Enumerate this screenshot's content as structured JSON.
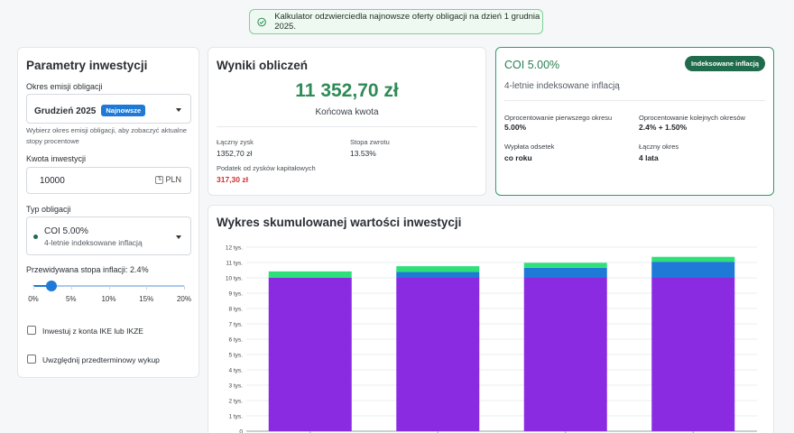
{
  "banner": {
    "text": "Kalkulator odzwierciedla najnowsze oferty obligacji na dzień 1 grudnia 2025."
  },
  "params": {
    "title": "Parametry inwestycji",
    "issue_label": "Okres emisji obligacji",
    "issue_value": "Grudzień 2025",
    "issue_badge": "Najnowsze",
    "issue_hint": "Wybierz okres emisji obligacji, aby zobaczyć aktualne stopy procentowe",
    "amount_label": "Kwota inwestycji",
    "amount_value": "10000",
    "amount_unit": "PLN",
    "type_label": "Typ obligacji",
    "type_value": "COI 5.00%",
    "type_desc": "4-letnie indeksowane inflacją",
    "inflation_label": "Przewidywana stopa inflacji: 2.4%",
    "inflation_value_percent": 2.4,
    "inflation_max_percent": 20,
    "inflation_ticks": [
      "0%",
      "5%",
      "10%",
      "15%",
      "20%"
    ],
    "ike_label": "Inwestuj z konta IKE lub IKZE",
    "early_label": "Uwzględnij przedterminowy wykup"
  },
  "results": {
    "title": "Wyniki obliczeń",
    "final_amount": "11 352,70 zł",
    "final_label": "Końcowa kwota",
    "total_profit_label": "Łączny zysk",
    "total_profit_value": "1352,70 zł",
    "return_label": "Stopa zwrotu",
    "return_value": "13.53%",
    "tax_label": "Podatek od zysków kapitałowych",
    "tax_value": "317,30 zł"
  },
  "bond": {
    "title": "COI 5.00%",
    "badge": "Indeksowane inflacją",
    "subtitle": "4-letnie indeksowane inflacją",
    "first_rate_label": "Oprocentowanie pierwszego okresu",
    "first_rate_value": "5.00%",
    "next_rate_label": "Oprocentowanie kolejnych okresów",
    "next_rate_value": "2.4% + 1.50%",
    "payout_label": "Wypłata odsetek",
    "payout_value": "co roku",
    "period_label": "Łączny okres",
    "period_value": "4 lata"
  },
  "chart": {
    "title": "Wykres skumulowanej wartości inwestycji"
  },
  "chart_data": {
    "type": "bar",
    "stacked": true,
    "categories": [
      "",
      "",
      "",
      ""
    ],
    "series": [
      {
        "color": "#8a2be2",
        "values": [
          10000,
          10000,
          10000,
          10000
        ]
      },
      {
        "color": "#1e7ad6",
        "values": [
          0,
          380,
          660,
          1050
        ]
      },
      {
        "color": "#2ee07a",
        "values": [
          420,
          380,
          320,
          320
        ]
      }
    ],
    "y_ticks": [
      "0",
      "1 tys.",
      "2 tys.",
      "3 tys.",
      "4 tys.",
      "5 tys.",
      "6 tys.",
      "7 tys.",
      "8 tys.",
      "9 tys.",
      "10 tys.",
      "11 tys.",
      "12 tys."
    ],
    "ylim": [
      0,
      12000
    ],
    "grid": true
  },
  "colors": {
    "accent_green": "#2e8b57",
    "accent_blue": "#1e7ad6",
    "tax_red": "#d32f2f",
    "badge_dark_green": "#1f6b4c"
  },
  "icons": {
    "banner": "check-circle-icon",
    "type_marker": "dot-icon",
    "dropdown": "chevron-down-icon"
  }
}
